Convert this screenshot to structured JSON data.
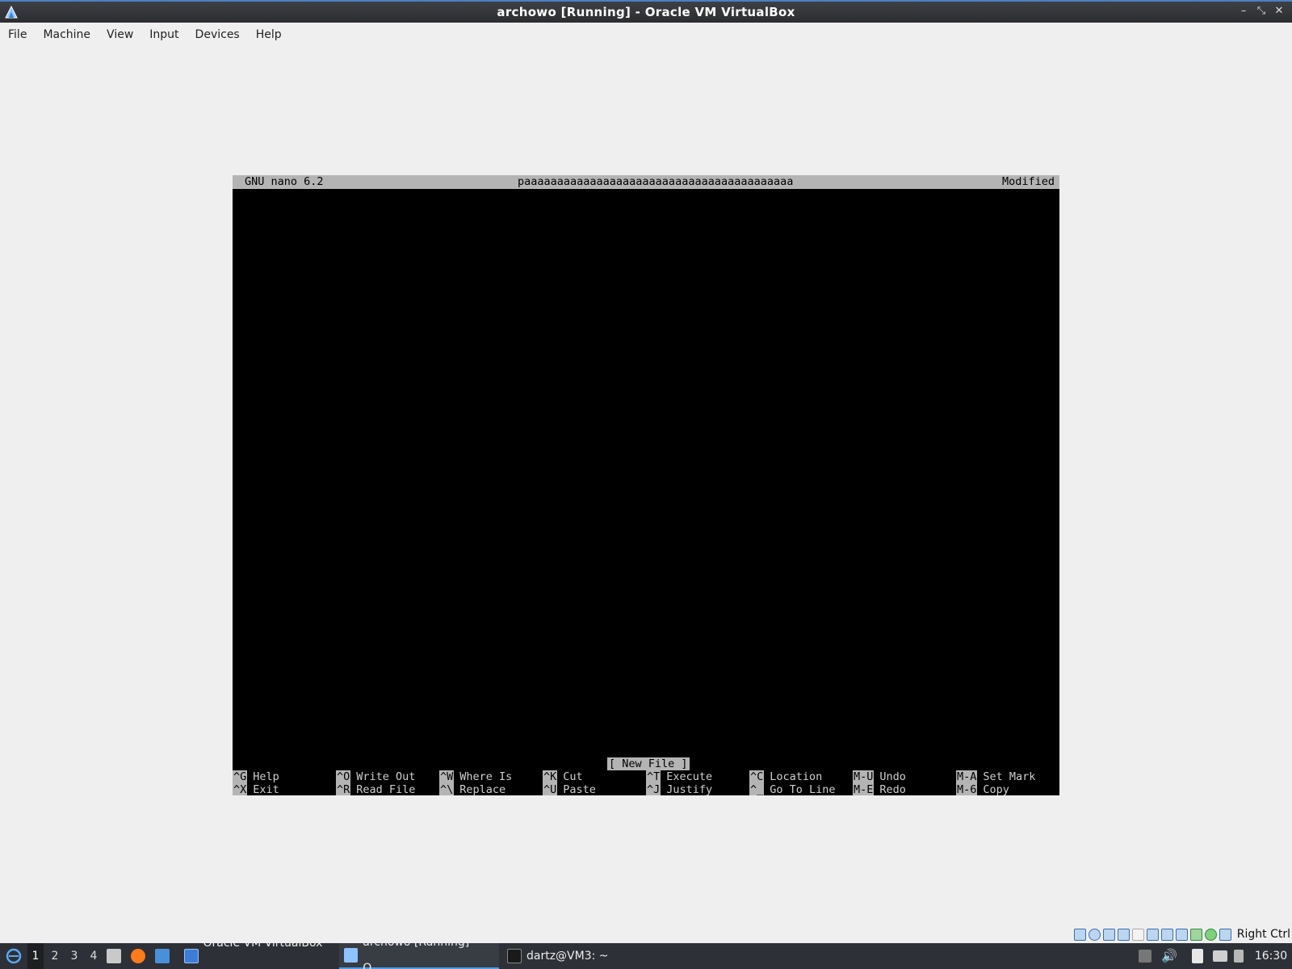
{
  "window": {
    "title": "archowo [Running] - Oracle VM VirtualBox",
    "controls": [
      "–",
      "⤡",
      "✕"
    ]
  },
  "menubar": [
    "File",
    "Machine",
    "View",
    "Input",
    "Devices",
    "Help"
  ],
  "nano": {
    "header_left": "GNU nano 6.2",
    "filename": "paaaaaaaaaaaaaaaaaaaaaaaaaaaaaaaaaaaaaaaaa",
    "header_right": "Modified",
    "status": "[ New File ]",
    "shortcuts_row1": [
      {
        "key": "^G",
        "label": "Help"
      },
      {
        "key": "^O",
        "label": "Write Out"
      },
      {
        "key": "^W",
        "label": "Where Is"
      },
      {
        "key": "^K",
        "label": "Cut"
      },
      {
        "key": "^T",
        "label": "Execute"
      },
      {
        "key": "^C",
        "label": "Location"
      },
      {
        "key": "M-U",
        "label": "Undo"
      },
      {
        "key": "M-A",
        "label": "Set Mark"
      }
    ],
    "shortcuts_row2": [
      {
        "key": "^X",
        "label": "Exit"
      },
      {
        "key": "^R",
        "label": "Read File"
      },
      {
        "key": "^\\",
        "label": "Replace"
      },
      {
        "key": "^U",
        "label": "Paste"
      },
      {
        "key": "^J",
        "label": "Justify"
      },
      {
        "key": "^_",
        "label": "Go To Line"
      },
      {
        "key": "M-E",
        "label": "Redo"
      },
      {
        "key": "M-6",
        "label": "Copy"
      }
    ]
  },
  "vbox_status": {
    "icons": [
      "hard-disk-icon",
      "optical-drive-icon",
      "audio-icon",
      "network-icon",
      "usb-icon",
      "shared-folder-icon",
      "display-icon",
      "recording-icon",
      "virtualization-icon",
      "mouse-integration-icon",
      "keyboard-icon"
    ],
    "host_key": "Right Ctrl"
  },
  "taskbar": {
    "workspaces": [
      "1",
      "2",
      "3",
      "4"
    ],
    "tasks": [
      {
        "label": "Oracle VM VirtualBox ..."
      },
      {
        "label": "archowo [Running] - O..."
      },
      {
        "label": "dartz@VM3: ~"
      }
    ],
    "clock": "16:30"
  }
}
